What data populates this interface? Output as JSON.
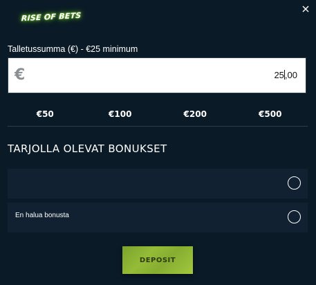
{
  "brand": {
    "logo_text": "Rise of Bets",
    "accent": "#8fd13f"
  },
  "header": {
    "close_icon": "close-icon"
  },
  "amount": {
    "label": "Talletussumma (€) - €25 minimum",
    "currency_symbol": "€",
    "value_before_caret": "25",
    "value_after_caret": ",00"
  },
  "presets": [
    {
      "label": "€50"
    },
    {
      "label": "€100"
    },
    {
      "label": "€200"
    },
    {
      "label": "€500"
    }
  ],
  "bonuses": {
    "title": "TARJOLLA OLEVAT BONUKSET",
    "options": [
      {
        "label": "",
        "selected": false
      },
      {
        "label": "En halua bonusta",
        "selected": false
      }
    ]
  },
  "actions": {
    "deposit_label": "DEPOSIT",
    "deposit_color": "#94bc37"
  }
}
